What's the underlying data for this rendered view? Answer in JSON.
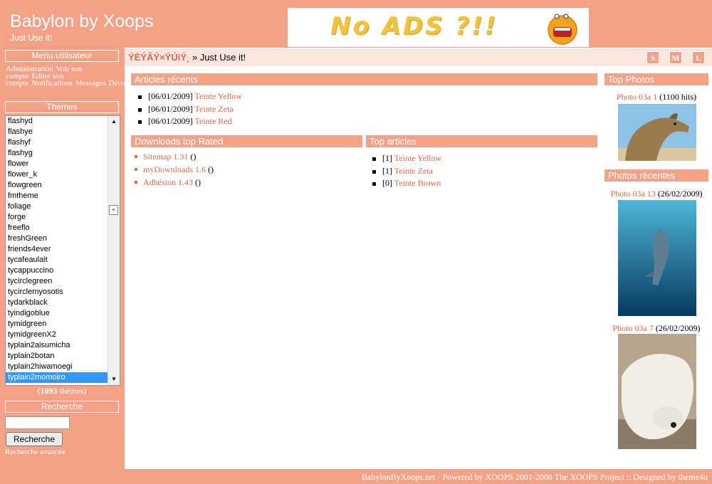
{
  "header": {
    "site_title": "Babylon by Xoops",
    "slogan": "Just Use it!",
    "banner_text": "No ADS ?!!"
  },
  "user_menu": {
    "title": "Menu utilisateur",
    "items": [
      "Administration",
      "Voir son compte",
      "Editer son compte",
      "Notifications",
      "Messages",
      "Déconnexion"
    ]
  },
  "themes": {
    "title": "Themes",
    "items": [
      "flashyd",
      "flashye",
      "flashyf",
      "flashyg",
      "flower",
      "flower_k",
      "flowgreen",
      "fmtheme",
      "foliage",
      "forge",
      "freeflo",
      "freshGreen",
      "friends4ever",
      "tycafeaulait",
      "tycappuccino",
      "tycirclegreen",
      "tycirclemyosotis",
      "tydarkblack",
      "tyindigoblue",
      "tymidgreen",
      "tymidgreenX2",
      "typlain2aisumicha",
      "typlain2botan",
      "typlain2hiwamoegi",
      "typlain2momoiro"
    ],
    "selected": "typlain2momoiro",
    "count_prefix": "(",
    "count": "1093",
    "count_suffix": " thèmes)"
  },
  "search": {
    "title": "Recherche",
    "button": "Recherche",
    "advanced": "Recherche avancée"
  },
  "breadcrumb": {
    "home": "ÝÈÝÂÝ×ÝÚìÝ¸",
    "separator": "»",
    "current": "Just Use it!"
  },
  "font_size_buttons": [
    "S",
    "M",
    "L"
  ],
  "articles_recents": {
    "title": "Articles récents",
    "items": [
      {
        "date": "[06/01/2009]",
        "title": "Teinte Yellow"
      },
      {
        "date": "[06/01/2009]",
        "title": "Teinte Zeta"
      },
      {
        "date": "[06/01/2009]",
        "title": "Teinte Red"
      }
    ]
  },
  "downloads_top": {
    "title": "Downloads top Rated",
    "items": [
      {
        "title": "Sitemap 1.31",
        "suffix": " ()"
      },
      {
        "title": "myDownloads 1.6",
        "suffix": " ()"
      },
      {
        "title": "Adhésion 1.43",
        "suffix": " ()"
      }
    ]
  },
  "top_articles": {
    "title": "Top articles",
    "items": [
      {
        "rank": "[1]",
        "title": "Teinte Yellow"
      },
      {
        "rank": "[1]",
        "title": "Teinte Zeta"
      },
      {
        "rank": "[0]",
        "title": "Teinte Brown"
      }
    ]
  },
  "top_photos": {
    "title": "Top Photos",
    "photo_title": "Photo 03a 1",
    "photo_meta": " (1100 hits)"
  },
  "photos_recentes": {
    "title": "Photos récentes",
    "items": [
      {
        "title": "Photo 03a 13",
        "meta": " (26/02/2009)"
      },
      {
        "title": "Photo 03a 7",
        "meta": " (26/02/2009)"
      }
    ]
  },
  "footer": {
    "text": "BabylonByXoops.net - Powered by XOOPS 2001-2008 The XOOPS Project :: Designed by theme4u"
  },
  "colors": {
    "accent": "#f4a287",
    "link": "#d9694a",
    "breadcrumb_bg": "#fbe6de",
    "selected": "#3399ff"
  }
}
